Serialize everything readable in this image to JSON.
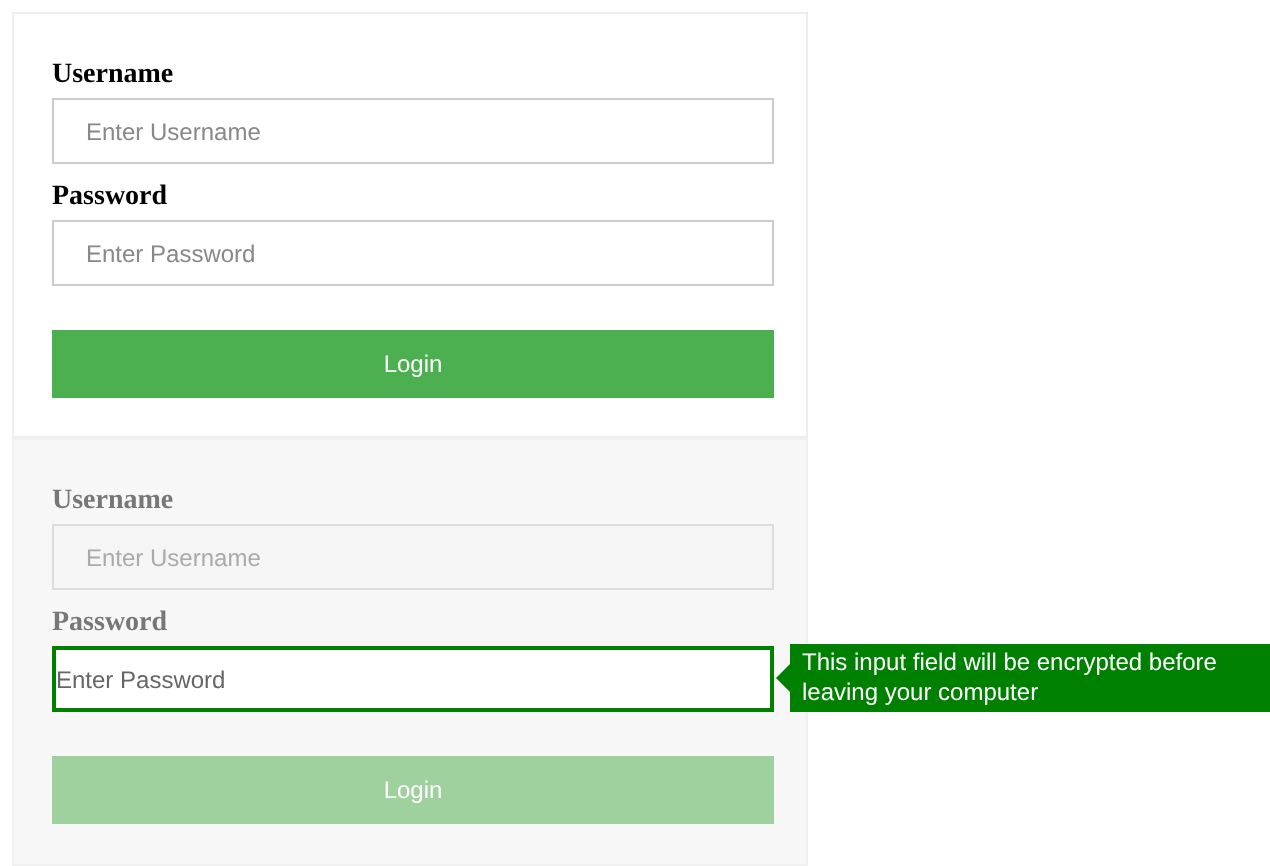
{
  "forms": [
    {
      "disabled": false,
      "fields": [
        {
          "label": "Username",
          "placeholder": "Enter Username",
          "focused": false
        },
        {
          "label": "Password",
          "placeholder": "Enter Password",
          "focused": false
        }
      ],
      "button": "Login"
    },
    {
      "disabled": true,
      "fields": [
        {
          "label": "Username",
          "placeholder": "Enter Username",
          "focused": false
        },
        {
          "label": "Password",
          "placeholder": "Enter Password",
          "focused": true,
          "tooltip": "This input field will be encrypted before leaving your computer"
        }
      ],
      "button": "Login"
    }
  ]
}
